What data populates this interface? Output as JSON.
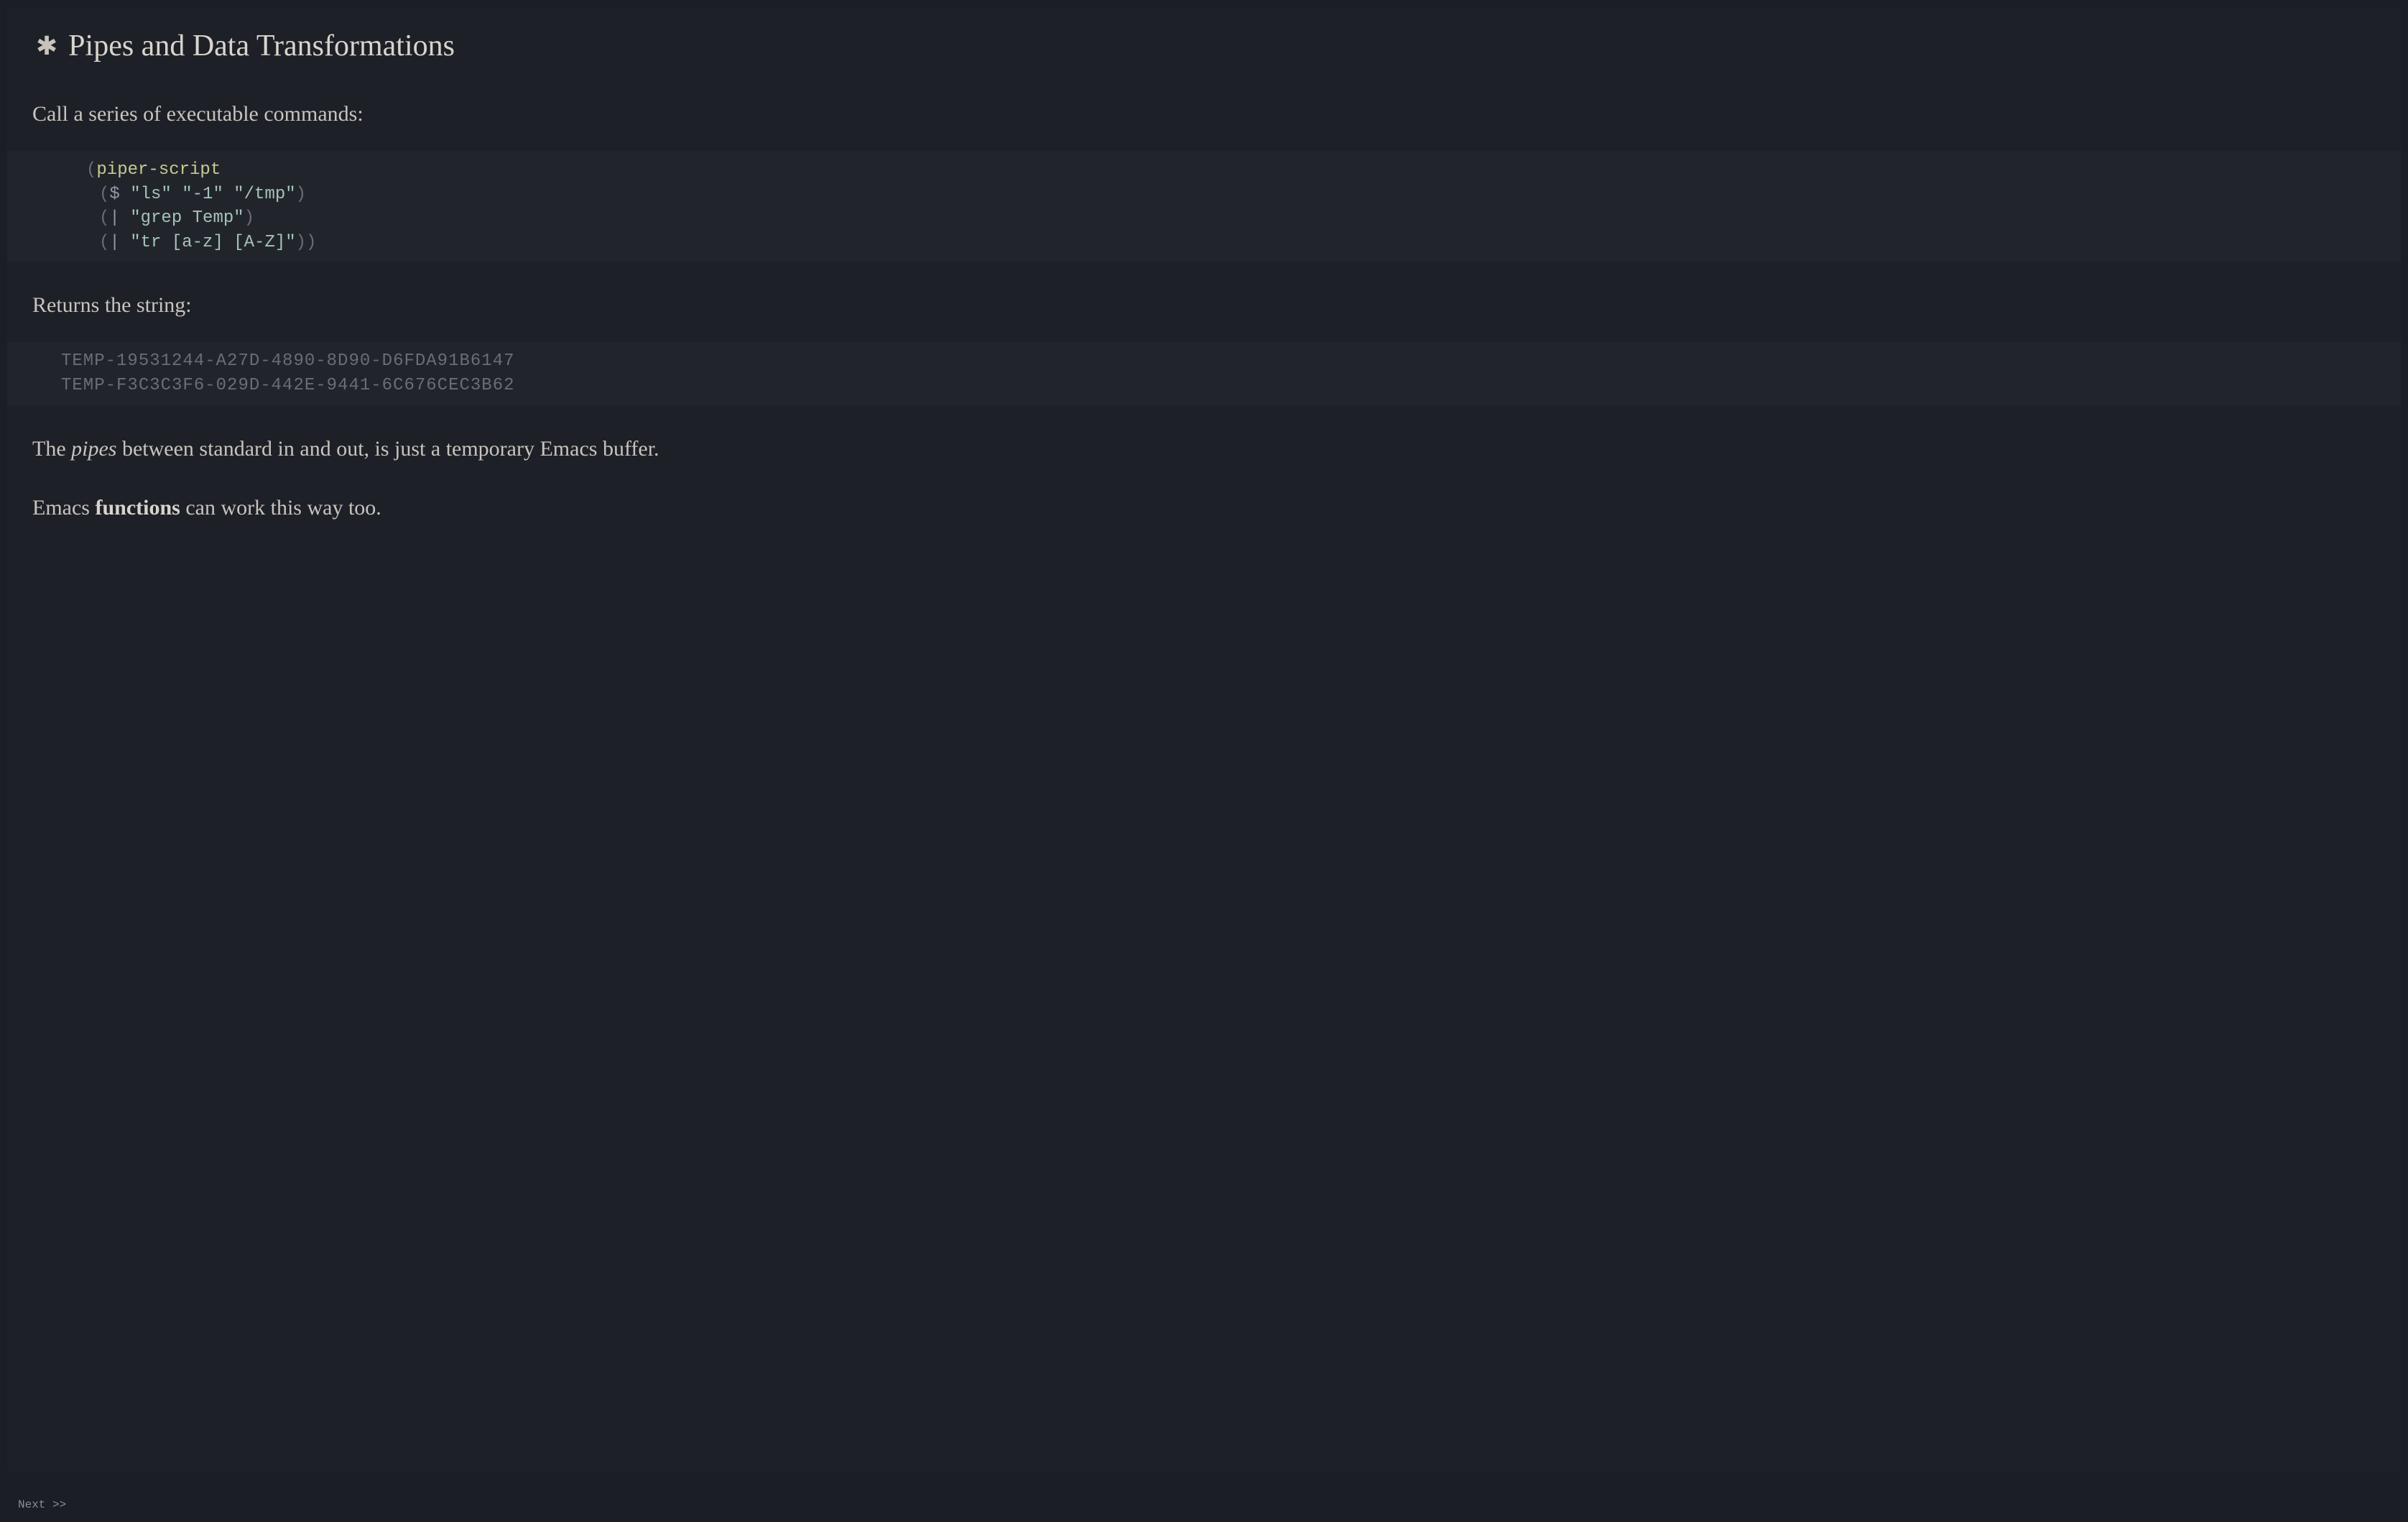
{
  "title": "Pipes and Data Transformations",
  "para1": "Call a series of executable commands:",
  "code": {
    "line1": {
      "open": "(",
      "fn": "piper-script"
    },
    "line2": {
      "open": "(",
      "op": "$",
      "sp": " ",
      "s1": "\"ls\"",
      "sp2": " ",
      "s2": "\"-1\"",
      "sp3": " ",
      "s3": "\"/tmp\"",
      "close": ")"
    },
    "line3": {
      "open": "(",
      "op": "|",
      "sp": " ",
      "s1": "\"grep Temp\"",
      "close": ")"
    },
    "line4": {
      "open": "(",
      "op": "|",
      "sp": " ",
      "s1": "\"tr [a-z] [A-Z]\"",
      "close": "))"
    }
  },
  "para2": "Returns the string:",
  "output": {
    "line1": "TEMP-19531244-A27D-4890-8D90-D6FDA91B6147",
    "line2": "TEMP-F3C3C3F6-029D-442E-9441-6C676CEC3B62"
  },
  "para3": {
    "t1": "The ",
    "italic": "pipes",
    "t2": " between standard in and out, is just a temporary Emacs buffer."
  },
  "para4": {
    "t1": "Emacs ",
    "bold": "functions",
    "t2": " can work this way too."
  },
  "footer": "Next >>"
}
